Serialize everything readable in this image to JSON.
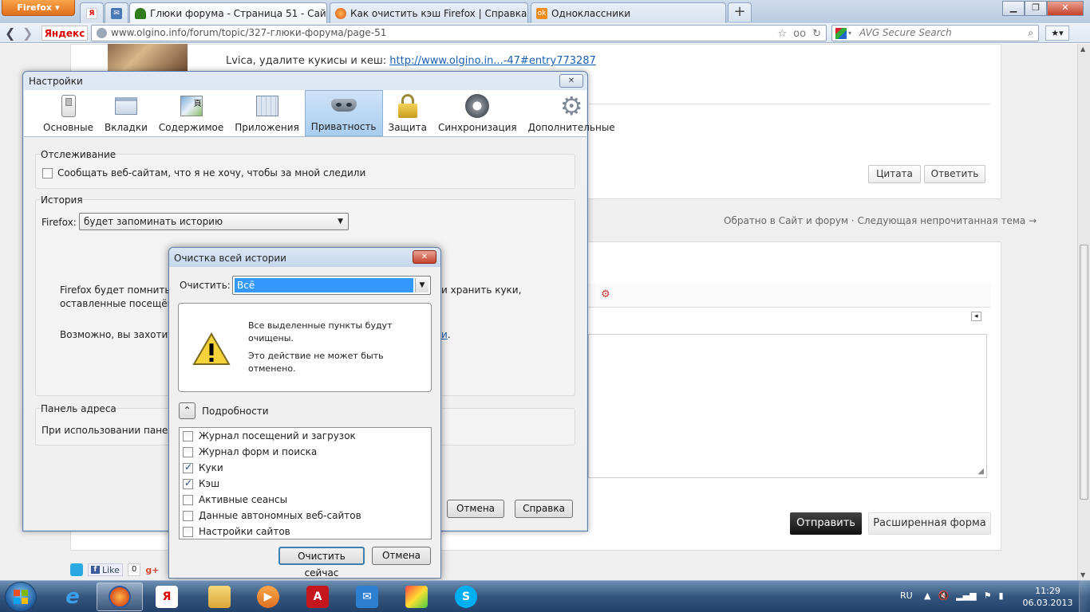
{
  "browser": {
    "menu_button": "Firefox",
    "tabs": [
      {
        "title": "Глюки форума - Страница 51 - Сай..."
      },
      {
        "title": "Как очистить кэш Firefox | Справка ..."
      },
      {
        "title": "Одноклассники"
      }
    ],
    "new_tab": "+",
    "yandex_logo": "Яндекс",
    "url": "www.olgino.info/forum/topic/327-глюки-форума/page-51",
    "search_placeholder": "AVG Secure Search"
  },
  "page": {
    "post_text_prefix": "Lvica, удалите кукисы и кеш: ",
    "post_link": "http://www.olgino.in...-47#entry773287",
    "quote_button": "Цитата",
    "reply_button": "Ответить",
    "back_link": "Обратно в Сайт и форум",
    "separator": "·",
    "next_topic_link": "Следующая непрочитанная тема →",
    "send_button": "Отправить",
    "advanced_form_button": "Расширенная форма",
    "fb_like": "Like",
    "fb_count": "0"
  },
  "options": {
    "title": "Настройки",
    "panes": [
      {
        "label": "Основные",
        "icon": "switch-icon"
      },
      {
        "label": "Вкладки",
        "icon": "tabs-icon"
      },
      {
        "label": "Содержимое",
        "icon": "content-icon"
      },
      {
        "label": "Приложения",
        "icon": "applications-icon"
      },
      {
        "label": "Приватность",
        "icon": "mask-icon",
        "selected": true
      },
      {
        "label": "Защита",
        "icon": "lock-icon"
      },
      {
        "label": "Синхронизация",
        "icon": "sync-icon"
      },
      {
        "label": "Дополнительные",
        "icon": "gear-icon"
      }
    ],
    "tracking": {
      "heading": "Отслеживание",
      "dnt_label": "Сообщать веб-сайтам, что я не хочу, чтобы за мной следили",
      "dnt_checked": false
    },
    "history": {
      "heading": "История",
      "firefox_label": "Firefox:",
      "mode_value": "будет запоминать историю",
      "desc_left": "Firefox будет помнить ист",
      "desc_right": "и хранить куки,",
      "desc_line2": "оставленные посещённ",
      "maybe_left": "Возможно, вы захотите",
      "maybe_link": "о",
      "maybe_link_right": "и",
      "maybe_dot": "."
    },
    "address_bar": {
      "heading": "Панель адреса",
      "desc": "При использовании панели а"
    },
    "cancel_button": "Отмена",
    "help_button": "Справка"
  },
  "clear_dialog": {
    "title": "Очистка всей истории",
    "range_label": "Очистить:",
    "range_value": "Всё",
    "warning_line1": "Все выделенные пункты будут очищены.",
    "warning_line2": "Это действие не может быть отменено.",
    "details_label": "Подробности",
    "details_toggle": "⌃",
    "items": [
      {
        "label": "Журнал посещений и загрузок",
        "checked": false
      },
      {
        "label": "Журнал форм и поиска",
        "checked": false
      },
      {
        "label": "Куки",
        "checked": true
      },
      {
        "label": "Кэш",
        "checked": true
      },
      {
        "label": "Активные сеансы",
        "checked": false
      },
      {
        "label": "Данные автономных веб-сайтов",
        "checked": false
      },
      {
        "label": "Настройки сайтов",
        "checked": false
      }
    ],
    "clear_now_button": "Очистить сейчас",
    "cancel_button": "Отмена"
  },
  "taskbar": {
    "language": "RU",
    "time": "11:29",
    "date": "06.03.2013"
  },
  "colors": {
    "selection": "#3399ff",
    "firefox_orange": "#e06f1d",
    "link": "#1a5fb4"
  }
}
